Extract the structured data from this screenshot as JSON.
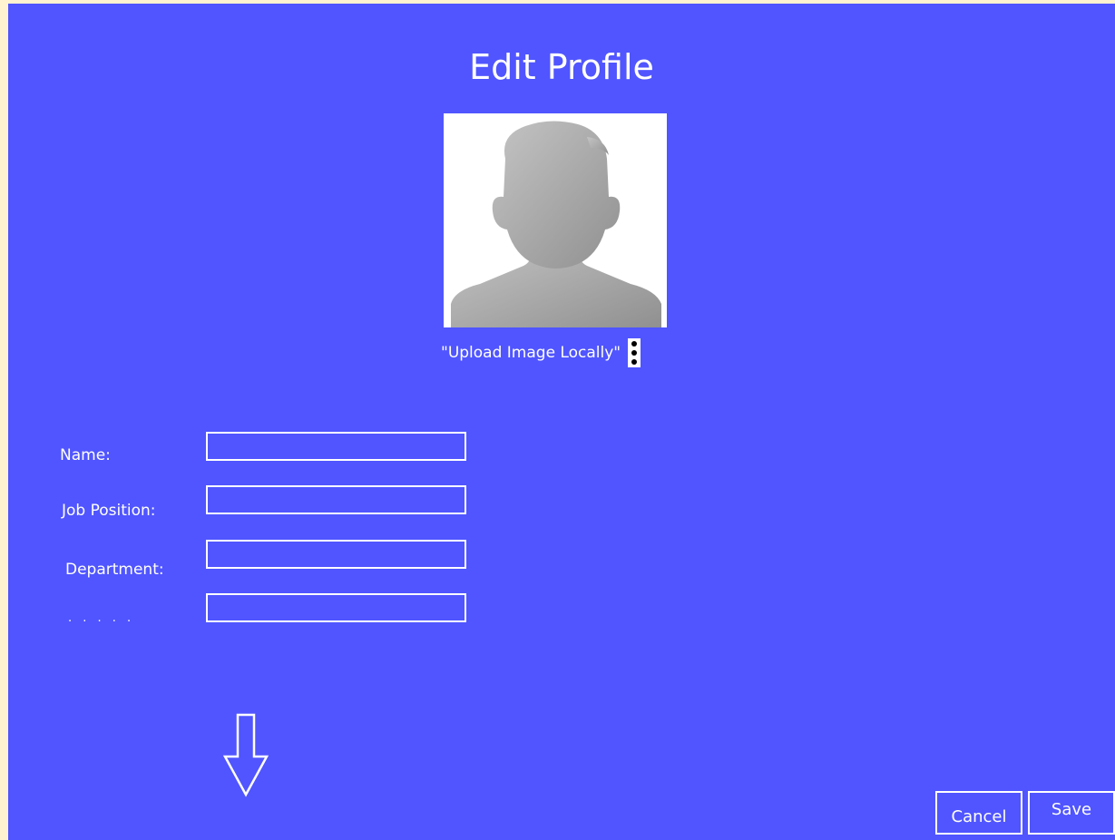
{
  "header": {
    "title": "Edit Profile"
  },
  "avatar": {
    "icon": "person-silhouette-icon",
    "upload_label": "\"Upload Image Locally\"",
    "menu_icon": "kebab-menu-icon"
  },
  "form": {
    "fields": [
      {
        "label": "Name:",
        "value": ""
      },
      {
        "label": "Job Position:",
        "value": ""
      },
      {
        "label": "Department:",
        "value": ""
      },
      {
        "label": ". . . . .",
        "value": ""
      }
    ]
  },
  "scroll_hint": {
    "icon": "down-arrow-icon"
  },
  "actions": {
    "cancel_label": "Cancel",
    "save_label": "Save"
  },
  "colors": {
    "background": "#5055ff",
    "foreground": "#ffffff",
    "page_border": "#fff3d0"
  }
}
